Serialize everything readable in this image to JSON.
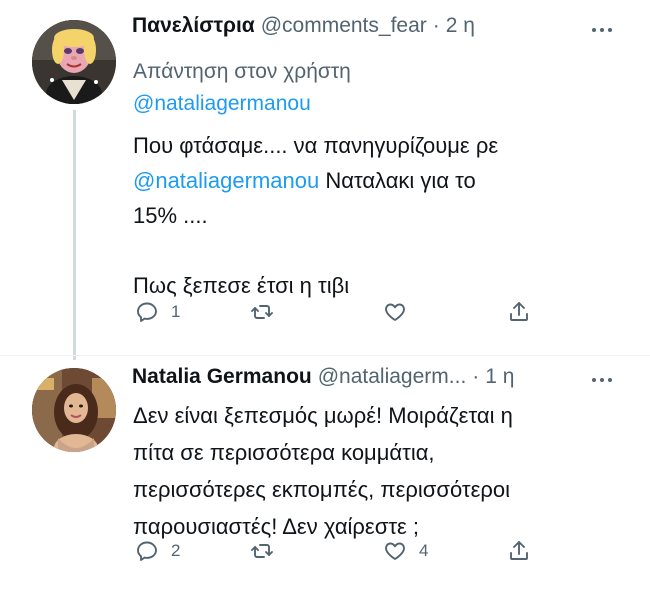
{
  "tweets": [
    {
      "name": "Πανελίστρια",
      "handle": "@comments_fear",
      "time": "2 η",
      "reply_prefix": "Απάντηση στον χρήστη",
      "reply_mention": "@nataliagermanou",
      "text_line1": "Που φτάσαμε.... να πανηγυρίζουμε ρε",
      "text_mention": "@nataliagermanou",
      "text_after_mention": " Ναταλακι για το",
      "text_line3": "15% ....",
      "text_line4": "Πως ξεπεσε έτσι η τιβι",
      "replies": "1",
      "retweets": "",
      "likes": "",
      "avatar_icon": "muppet-avatar"
    },
    {
      "name": "Natalia Germanou",
      "handle": "@nataliagerm...",
      "time": "1 η",
      "text": "Δεν είναι ξεπεσμός μωρέ! Μοιράζεται η\nπίτα σε περισσότερα κομμάτια,\nπερισσότερες εκπομπές, περισσότεροι\nπαρουσιαστές! Δεν χαίρεστε ;",
      "replies": "2",
      "retweets": "",
      "likes": "4",
      "avatar_icon": "woman-avatar"
    }
  ],
  "colors": {
    "link": "#1d9bf0",
    "secondary_text": "#536471",
    "primary_text": "#0f1419",
    "thread_line": "#cfd9de"
  }
}
